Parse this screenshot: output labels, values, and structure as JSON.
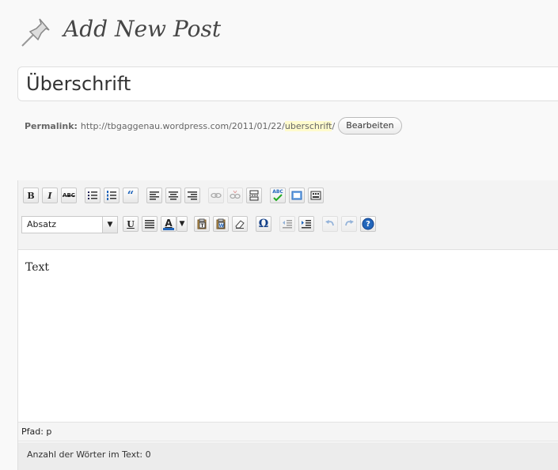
{
  "header": {
    "title": "Add New Post",
    "icon": "pushpin-icon"
  },
  "post_title": {
    "value": "Überschrift"
  },
  "permalink": {
    "label": "Permalink:",
    "base_url": "http://tbgaggenau.wordpress.com/2011/01/22/",
    "slug": "uberschrift",
    "trailing": "/",
    "edit_label": "Bearbeiten"
  },
  "toolbar": {
    "bold_label": "B",
    "italic_label": "I",
    "strike_label": "ABC",
    "blockquote_label": "“",
    "spellcheck_label": "ABC",
    "format_select": "Absatz",
    "underline_label": "U",
    "textcolor_label": "A",
    "special_char_label": "Ω",
    "help_label": "?"
  },
  "editor": {
    "content": "Text",
    "path": "Pfad: p",
    "word_count": "Anzahl der Wörter im Text: 0"
  },
  "colors": {
    "accent": "#21759b",
    "highlight": "#fffbcc",
    "text_color_bar": "#2266bb"
  }
}
